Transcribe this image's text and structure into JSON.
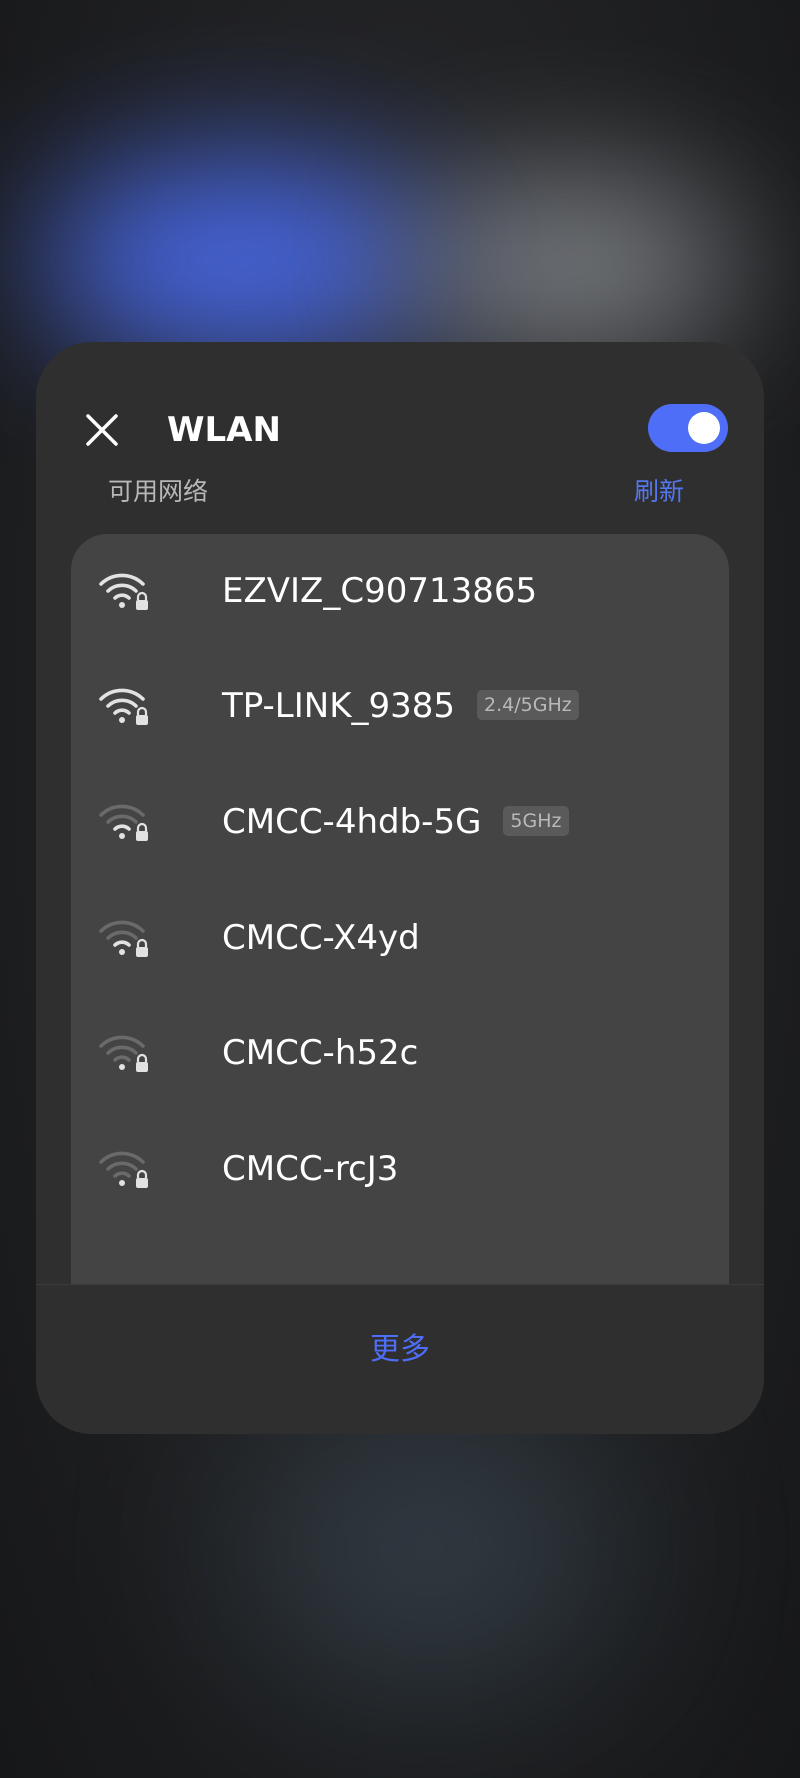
{
  "panel": {
    "title": "WLAN",
    "wlan_enabled": true,
    "section_label": "可用网络",
    "refresh_label": "刷新",
    "more_label": "更多"
  },
  "networks": [
    {
      "ssid": "EZVIZ_C90713865",
      "band": "",
      "signal": "strong",
      "secured": true
    },
    {
      "ssid": "TP-LINK_9385",
      "band": "2.4/5GHz",
      "signal": "strong",
      "secured": true
    },
    {
      "ssid": "CMCC-4hdb-5G",
      "band": "5GHz",
      "signal": "weak",
      "secured": true
    },
    {
      "ssid": "CMCC-X4yd",
      "band": "",
      "signal": "weak",
      "secured": true
    },
    {
      "ssid": "CMCC-h52c",
      "band": "",
      "signal": "weak",
      "secured": true
    },
    {
      "ssid": "CMCC-rcJ3",
      "band": "",
      "signal": "weak",
      "secured": true
    }
  ],
  "colors": {
    "accent": "#4f6ef7",
    "panel": "#2f2f2f",
    "list": "#444444"
  }
}
